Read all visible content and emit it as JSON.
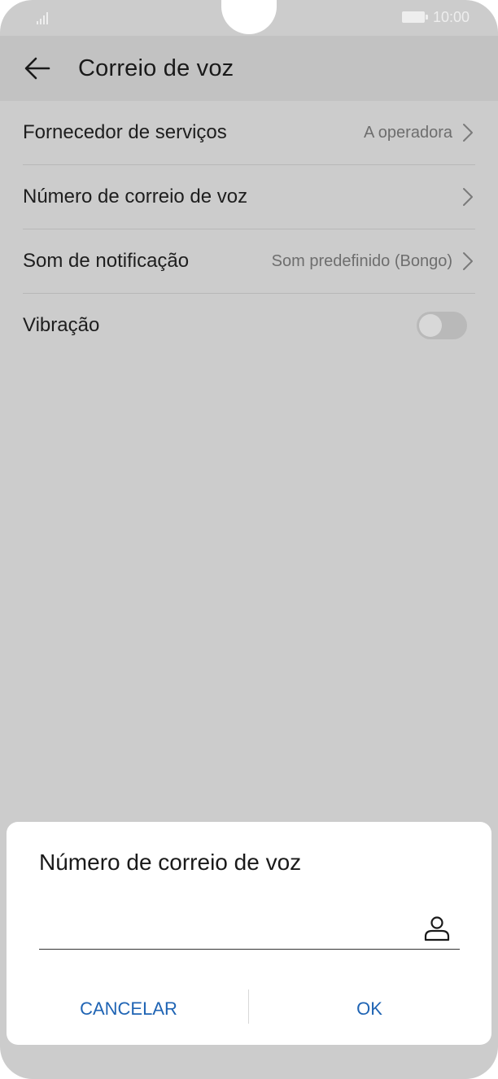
{
  "status_bar": {
    "time": "10:00",
    "signal_icon": "signal-icon",
    "battery_icon": "battery-icon"
  },
  "header": {
    "title": "Correio de voz",
    "back_icon": "arrow-left-icon"
  },
  "settings": {
    "items": [
      {
        "label": "Fornecedor de serviços",
        "value": "A operadora"
      },
      {
        "label": "Número de correio de voz",
        "value": ""
      },
      {
        "label": "Som de notificação",
        "value": "Som predefinido (Bongo)"
      },
      {
        "label": "Vibração"
      }
    ],
    "vibration_on": false
  },
  "dialog": {
    "title": "Número de correio de voz",
    "input_value": "",
    "contact_icon": "contact-icon",
    "cancel_label": "CANCELAR",
    "ok_label": "OK"
  },
  "colors": {
    "accent": "#1f64b4",
    "overlay_background": "#cccccc",
    "header_background": "#c2c2c2",
    "dialog_background": "#ffffff"
  }
}
